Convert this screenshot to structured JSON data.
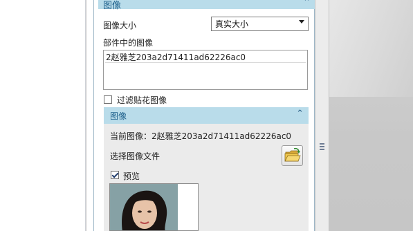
{
  "panel": {
    "section_title_top": "图像",
    "image_size_label": "图像大小",
    "image_size_value": "真实大小",
    "part_images_label": "部件中的图像",
    "part_images_list": [
      "2赵雅芝203a2d71411ad62226ac0"
    ],
    "filter_decal_label": "过滤贴花图像",
    "filter_decal_checked": false
  },
  "image_section": {
    "title": "图像",
    "current_image_label": "当前图像：2赵雅芝203a2d71411ad62226ac0",
    "select_file_label": "选择图像文件",
    "preview_label": "预览",
    "preview_checked": true
  },
  "icons": {
    "collapse_top": "chevron-up-icon",
    "collapse_section": "chevron-up-icon",
    "open_folder": "open-folder-icon",
    "dropdown": "chevron-down-icon",
    "splitter_grip": "grip-icon"
  },
  "colors": {
    "section_header": "#b9dcea",
    "section_title": "#1b5e8a",
    "section_body": "#ebebeb"
  }
}
